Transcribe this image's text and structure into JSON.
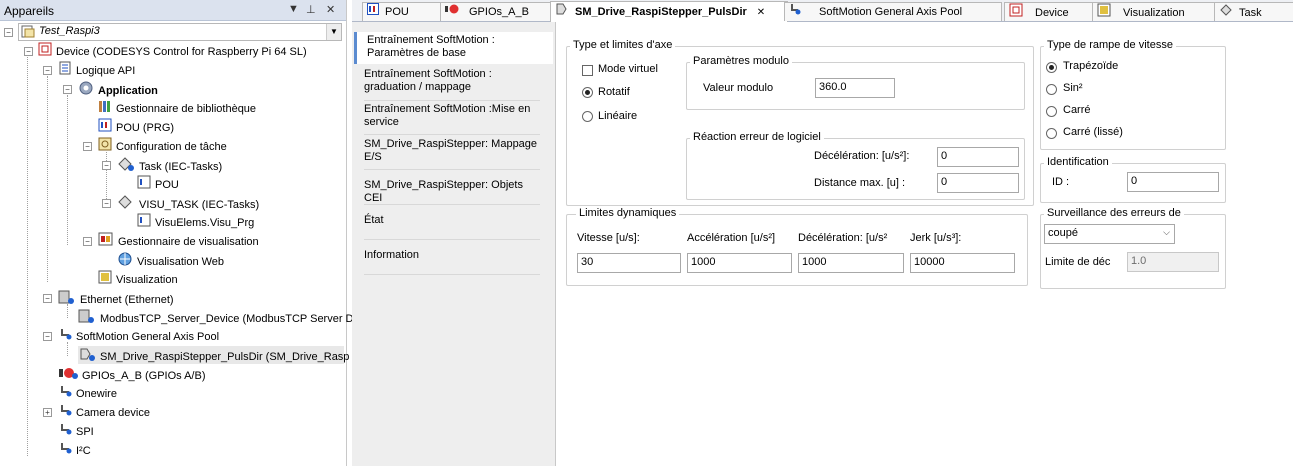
{
  "devices_panel": {
    "title": "Appareils",
    "project": "Test_Raspi3",
    "tree": {
      "device": "Device (CODESYS Control for Raspberry Pi 64 SL)",
      "plc_logic": "Logique API",
      "application": "Application",
      "library_manager": "Gestionnaire de bibliothèque",
      "pou": "POU (PRG)",
      "task_config": "Configuration de tâche",
      "task": "Task (IEC-Tasks)",
      "task_pou": "POU",
      "visu_task": "VISU_TASK (IEC-Tasks)",
      "visu_prg": "VisuElems.Visu_Prg",
      "visu_manager": "Gestionnaire de visualisation",
      "web_visu": "Visualisation Web",
      "visualization": "Visualization",
      "ethernet": "Ethernet (Ethernet)",
      "modbus": "ModbusTCP_Server_Device (ModbusTCP Server D",
      "axis_pool": "SoftMotion General Axis Pool",
      "drive": "SM_Drive_RaspiStepper_PulsDir (SM_Drive_Rasp",
      "gpios": "GPIOs_A_B (GPIOs A/B)",
      "onewire": "Onewire",
      "camera": "Camera device",
      "spi": "SPI",
      "i2c": "I²C"
    }
  },
  "tabs": [
    {
      "label": "POU"
    },
    {
      "label": "GPIOs_A_B"
    },
    {
      "label": "SM_Drive_RaspiStepper_PulsDir",
      "close": "✕"
    },
    {
      "label": "SoftMotion General Axis Pool"
    },
    {
      "label": "Device"
    },
    {
      "label": "Visualization"
    },
    {
      "label": "Task"
    }
  ],
  "side_tabs": [
    "Entraînement SoftMotion : Paramètres de base",
    "Entraînement SoftMotion : graduation / mappage",
    "Entraînement SoftMotion :Mise en service",
    "SM_Drive_RaspiStepper: Mappage E/S",
    "SM_Drive_RaspiStepper: Objets CEI",
    "État",
    "Information"
  ],
  "form": {
    "type_group": {
      "title": "Type et limites d'axe",
      "virtual": "Mode virtuel",
      "rotary": "Rotatif",
      "linear": "Linéaire",
      "virtual_checked": false,
      "mode": "Rotatif"
    },
    "modulo": {
      "title": "Paramètres modulo",
      "label": "Valeur modulo",
      "value": "360.0"
    },
    "software_error": {
      "title": "Réaction erreur de logiciel",
      "decel_label": "Décélération: [u/s²]:",
      "decel_value": "0",
      "distance_label": "Distance max. [u] :",
      "distance_value": "0"
    },
    "dynamic_limits": {
      "title": "Limites dynamiques",
      "speed_label": "Vitesse [u/s]:",
      "speed_value": "30",
      "accel_label": "Accélération [u/s²]",
      "accel_value": "1000",
      "decel_label": "Décélération: [u/s²",
      "decel_value": "1000",
      "jerk_label": "Jerk [u/s³]:",
      "jerk_value": "10000"
    },
    "ramp_type": {
      "title": "Type de rampe de vitesse",
      "options": [
        "Trapézoïde",
        "Sin²",
        "Carré",
        "Carré (lissé)"
      ],
      "selected": "Trapézoïde"
    },
    "identification": {
      "title": "Identification",
      "id_label": "ID :",
      "id_value": "0"
    },
    "error_monitoring": {
      "title": "Surveillance des erreurs de",
      "select_value": "coupé",
      "limit_label": "Limite de déc",
      "limit_value": "1.0"
    }
  }
}
